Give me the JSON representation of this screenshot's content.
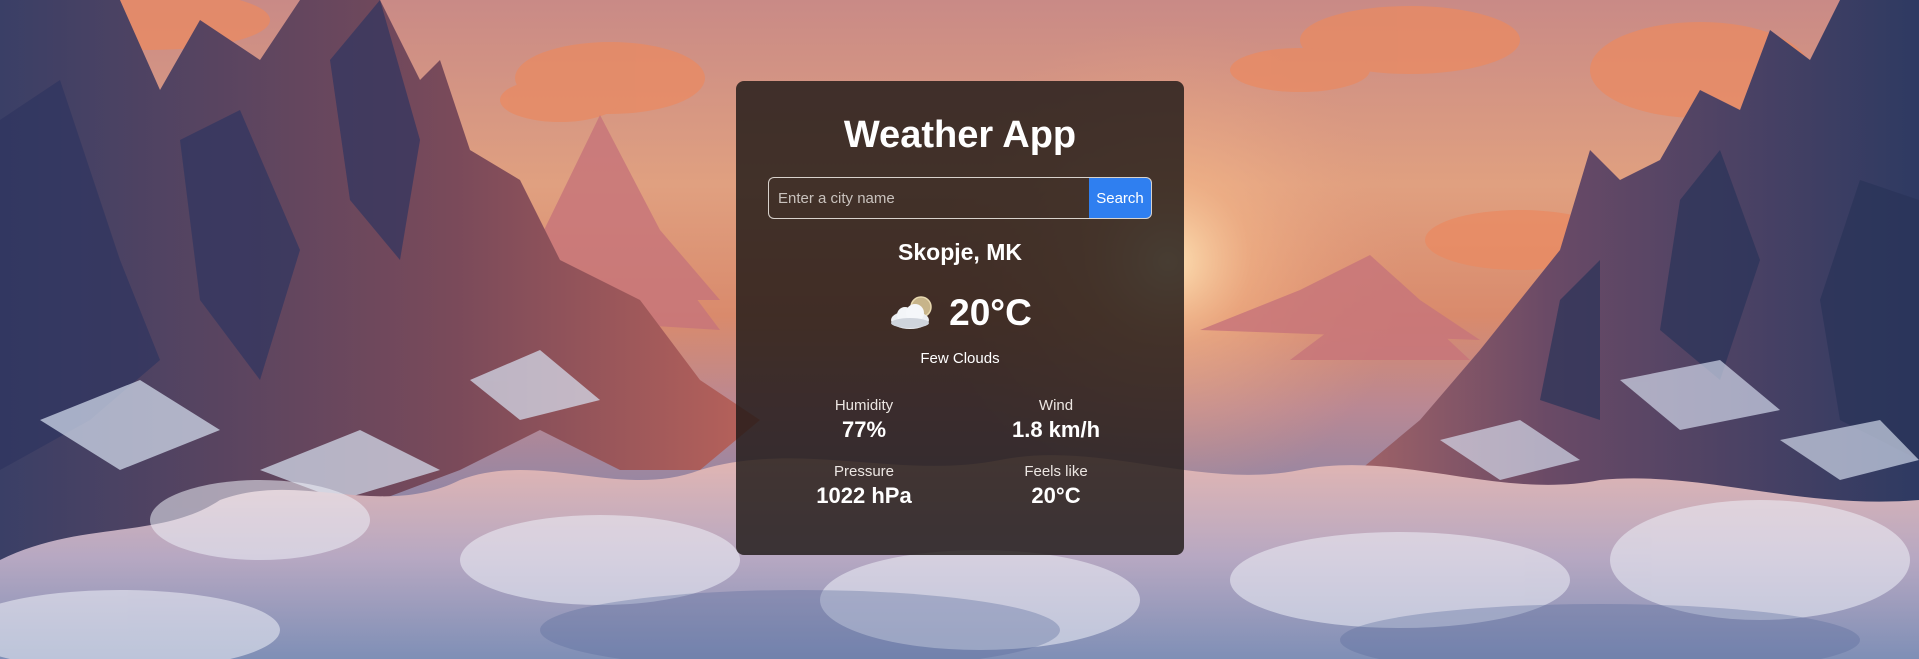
{
  "app": {
    "title": "Weather App"
  },
  "search": {
    "placeholder": "Enter a city name",
    "value": "",
    "button_label": "Search"
  },
  "weather": {
    "location": "Skopje, MK",
    "icon": "few-clouds-icon",
    "temperature": "20°C",
    "description": "Few Clouds",
    "details": [
      {
        "label": "Humidity",
        "value": "77%"
      },
      {
        "label": "Wind",
        "value": "1.8 km/h"
      },
      {
        "label": "Pressure",
        "value": "1022 hPa"
      },
      {
        "label": "Feels like",
        "value": "20°C"
      }
    ]
  },
  "colors": {
    "card_background": "#1e1816",
    "search_button": "#2f7ff0",
    "text": "#ffffff"
  }
}
